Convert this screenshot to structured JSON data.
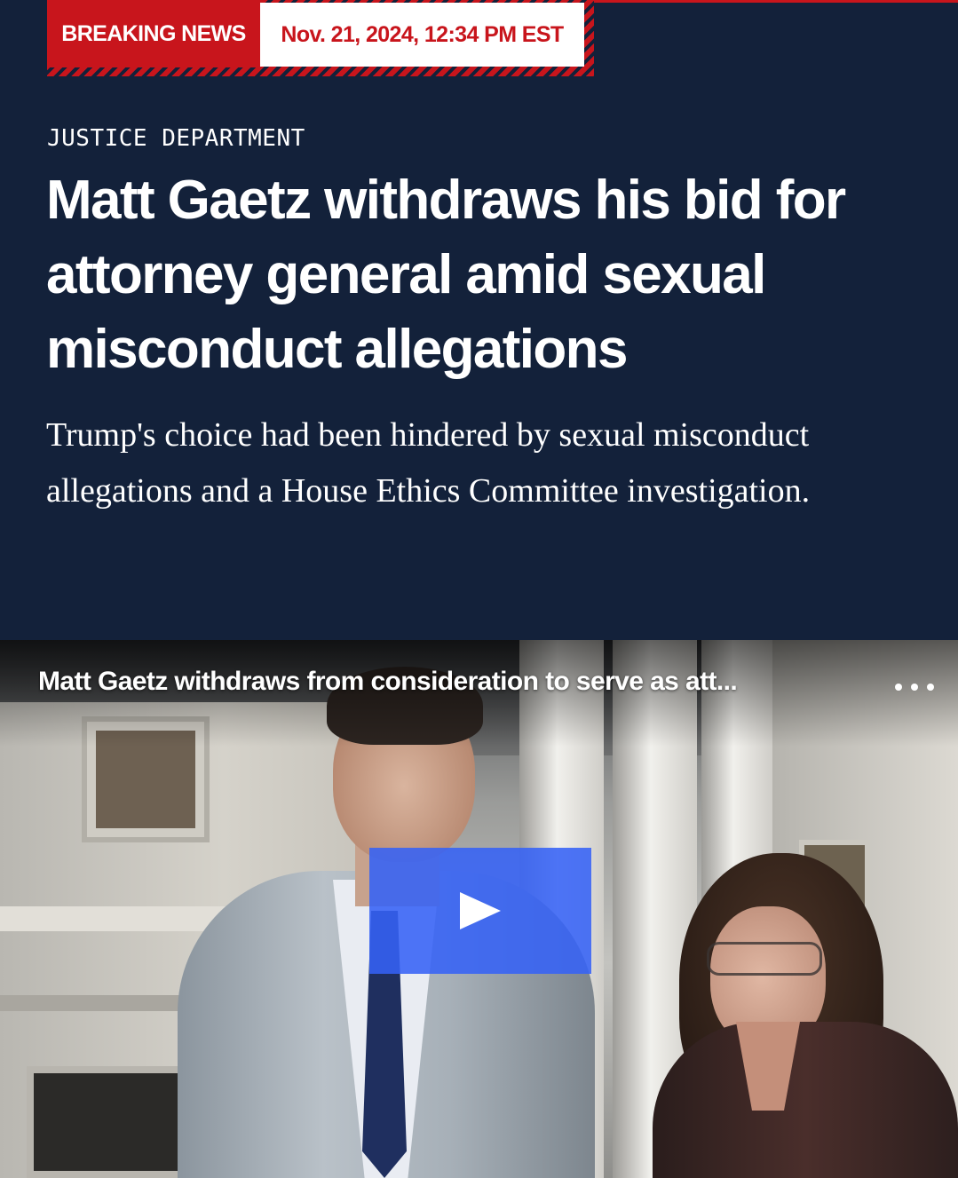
{
  "badge": {
    "breaking_label": "BREAKING NEWS",
    "timestamp": "Nov. 21, 2024, 12:34 PM EST"
  },
  "article": {
    "section": "JUSTICE DEPARTMENT",
    "headline": "Matt Gaetz withdraws his bid for attorney general amid sexual misconduct allegations",
    "dek": "Trump's choice had been hindered by sexual misconduct allegations and a House Ethics Committee investigation."
  },
  "video": {
    "title": "Matt Gaetz withdraws from consideration to serve as att...",
    "more_icon": "more-horizontal-icon",
    "play_icon": "play-icon"
  },
  "colors": {
    "background": "#13213a",
    "accent_red": "#c8151c",
    "play_blue": "#3662f6"
  }
}
